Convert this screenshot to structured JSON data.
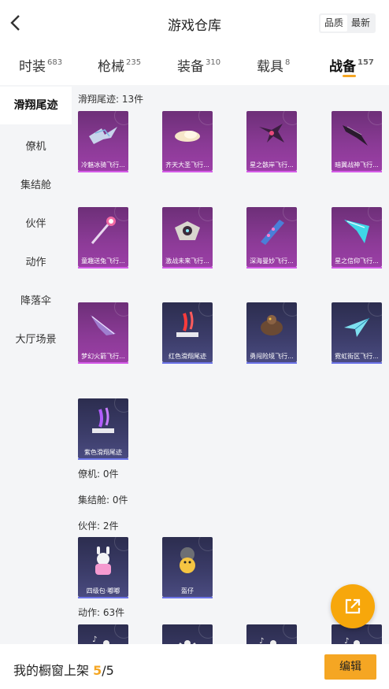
{
  "header": {
    "title": "游戏仓库",
    "sort_options": [
      "品质",
      "最新"
    ],
    "active_sort": "品质"
  },
  "tabs": [
    {
      "label": "时装",
      "count": "683"
    },
    {
      "label": "枪械",
      "count": "235"
    },
    {
      "label": "装备",
      "count": "310"
    },
    {
      "label": "载具",
      "count": "8"
    },
    {
      "label": "战备",
      "count": "157",
      "active": true
    }
  ],
  "sidebar": {
    "items": [
      {
        "label": "滑翔尾迹",
        "active": true
      },
      {
        "label": "僚机"
      },
      {
        "label": "集结舱"
      },
      {
        "label": "伙伴"
      },
      {
        "label": "动作"
      },
      {
        "label": "降落伞"
      },
      {
        "label": "大厅场景"
      }
    ]
  },
  "sections": {
    "glide_trail": {
      "title": "滑翔尾迹: 13件",
      "items": [
        {
          "name": "冷魅冰骑飞行...",
          "rarity": "purple",
          "icon": "ice-wing-icon"
        },
        {
          "name": "齐天大圣飞行...",
          "rarity": "purple",
          "icon": "cloud-icon"
        },
        {
          "name": "星之骸岸飞行...",
          "rarity": "purple",
          "icon": "dark-dragon-icon"
        },
        {
          "name": "暗翼战神飞行...",
          "rarity": "purple",
          "icon": "dark-wing-icon"
        },
        {
          "name": "童趣送兔飞行...",
          "rarity": "purple",
          "icon": "wand-icon"
        },
        {
          "name": "激战未来飞行...",
          "rarity": "purple",
          "icon": "robot-skull-icon"
        },
        {
          "name": "深海曼妙飞行...",
          "rarity": "purple",
          "icon": "fish-icon"
        },
        {
          "name": "星之信仰飞行...",
          "rarity": "purple",
          "icon": "blue-wing-icon"
        },
        {
          "name": "梦幻火箭飞行...",
          "rarity": "purple",
          "icon": "purple-wing-icon"
        },
        {
          "name": "红色滑翔尾迹",
          "rarity": "blue",
          "icon": "red-trail-icon"
        },
        {
          "name": "勇闯险境飞行...",
          "rarity": "blue",
          "icon": "beast-icon"
        },
        {
          "name": "霓虹街区飞行...",
          "rarity": "blue",
          "icon": "paper-plane-icon"
        },
        {
          "name": "紫色滑翔尾迹",
          "rarity": "blue",
          "icon": "purple-trail-icon"
        }
      ]
    },
    "wingman": {
      "title": "僚机: 0件"
    },
    "capsule": {
      "title": "集结舱: 0件"
    },
    "partner": {
      "title": "伙伴: 2件",
      "items": [
        {
          "name": "四级包·嘟嘟",
          "rarity": "blue",
          "icon": "bunny-robot-icon"
        },
        {
          "name": "盔仔",
          "rarity": "blue",
          "icon": "helmet-duck-icon"
        }
      ]
    },
    "emote": {
      "title": "动作: 63件"
    }
  },
  "footer": {
    "label": "我的橱窗上架",
    "current": "5",
    "total": "/5",
    "edit_label": "编辑"
  },
  "colors": {
    "accent": "#f5a623",
    "purple_card": "#8a3a95",
    "blue_card": "#3c3d6a"
  }
}
